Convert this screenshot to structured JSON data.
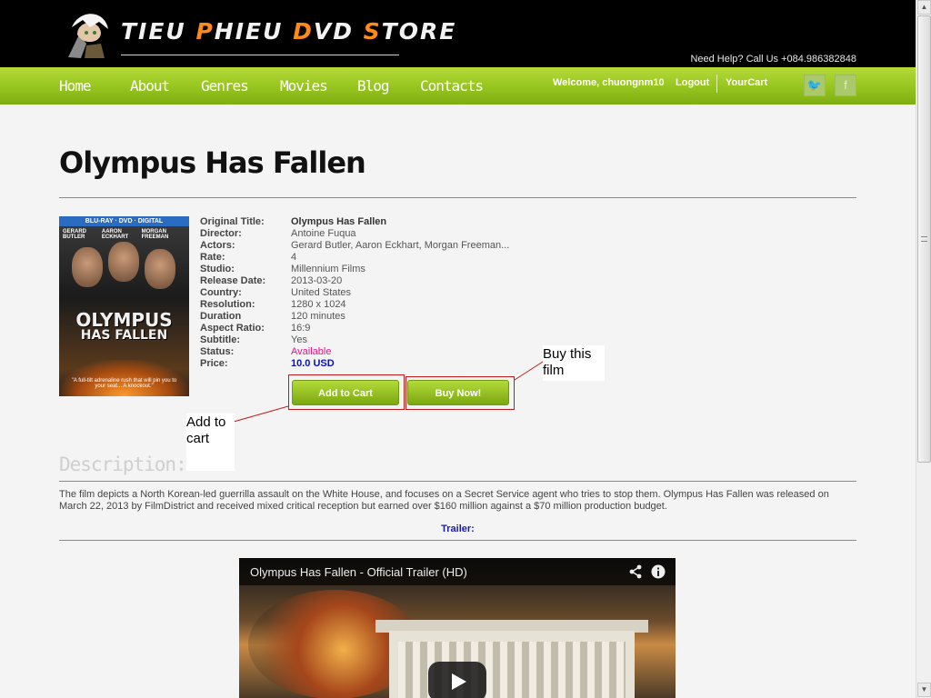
{
  "header": {
    "logo_text_parts": [
      "TIEU ",
      "P",
      "HIEU ",
      "D",
      "VD ",
      "S",
      "TORE"
    ],
    "help_text": "Need Help? Call Us +084.986382848"
  },
  "nav": {
    "items": [
      "Home",
      "About",
      "Genres",
      "Movies",
      "Blog",
      "Contacts"
    ],
    "welcome": "Welcome, chuongnm10",
    "logout": "Logout",
    "cart": "YourCart",
    "social": [
      {
        "icon": "twitter-icon",
        "glyph": "🐦"
      },
      {
        "icon": "facebook-icon",
        "glyph": "f"
      }
    ]
  },
  "page": {
    "title": "Olympus Has Fallen"
  },
  "poster": {
    "banner": "BLU-RAY · DVD · DIGITAL",
    "names": [
      "GERARD BUTLER",
      "AARON ECKHART",
      "MORGAN FREEMAN"
    ],
    "title_line1": "OLYMPUS",
    "title_line2": "HAS FALLEN",
    "quote": "\"A full-tilt adrenaline rush that will pin you to your seat... A knockout.\""
  },
  "details": [
    {
      "label": "Original Title:",
      "value": "Olympus Has Fallen"
    },
    {
      "label": "Director:",
      "value": "Antoine Fuqua"
    },
    {
      "label": "Actors:",
      "value": "Gerard Butler, Aaron Eckhart, Morgan Freeman..."
    },
    {
      "label": "Rate:",
      "value": "4"
    },
    {
      "label": "Studio:",
      "value": "Millennium Films"
    },
    {
      "label": "Release Date:",
      "value": "2013-03-20"
    },
    {
      "label": "Country:",
      "value": "United States"
    },
    {
      "label": "Resolution:",
      "value": "1280 x 1024"
    },
    {
      "label": "Duration",
      "value": "120 minutes"
    },
    {
      "label": "Aspect Ratio:",
      "value": "16:9"
    },
    {
      "label": "Subtitle:",
      "value": "Yes"
    },
    {
      "label": "Status:",
      "value": "Available"
    },
    {
      "label": "Price:",
      "value": "10.0 USD"
    }
  ],
  "actions": {
    "add_to_cart": "Add to Cart",
    "buy_now": "Buy Now!"
  },
  "callouts": {
    "buy": "Buy this film",
    "add": "Add to cart"
  },
  "description": {
    "heading": "Description:",
    "text": "The film depicts a North Korean-led guerrilla assault on the White House, and focuses on a Secret Service agent who tries to stop them. Olympus Has Fallen was released on March 22, 2013 by FilmDistrict and received mixed critical reception but earned over $160 million against a $70 million production budget.",
    "trailer_label": "Trailer:"
  },
  "video": {
    "title": "Olympus Has Fallen - Official Trailer (HD)",
    "share_icon": "share-icon",
    "info_icon": "info-icon"
  },
  "colors": {
    "nav_green": "#96c41f",
    "available": "#e6138a",
    "price": "#0a12b8",
    "callout_border": "#c41a1a"
  }
}
